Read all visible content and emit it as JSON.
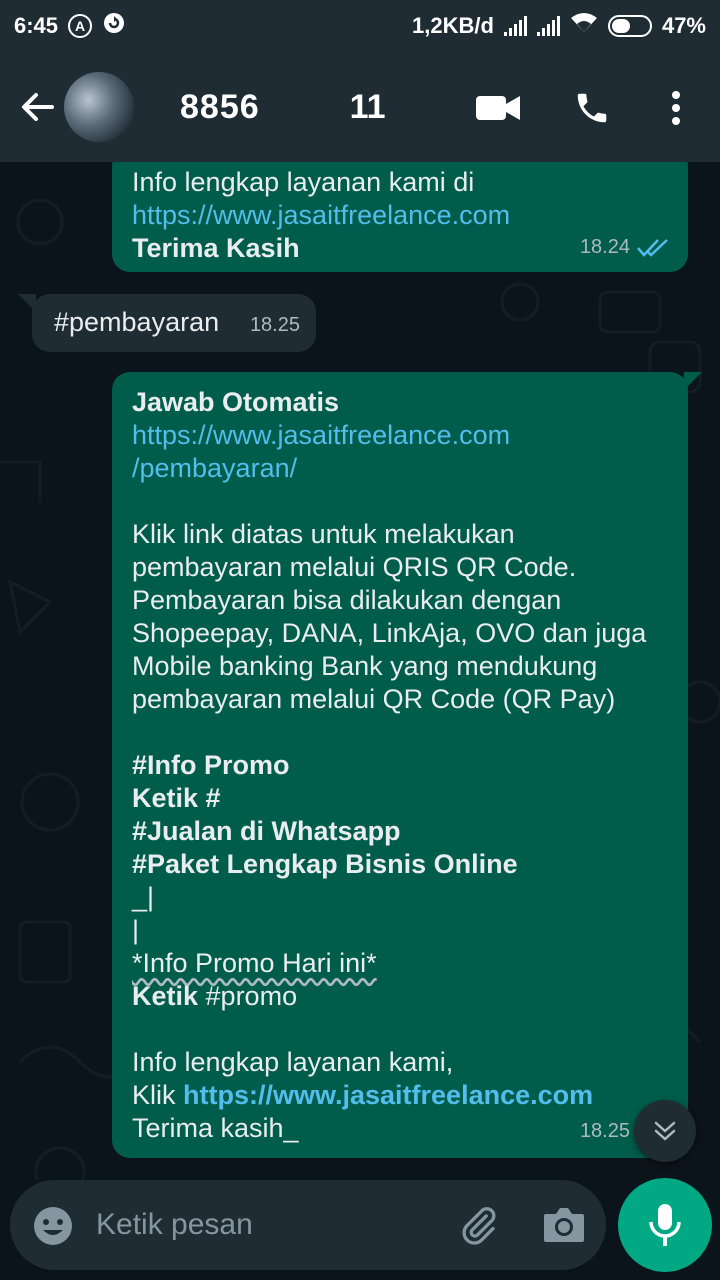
{
  "status_bar": {
    "time": "6:45",
    "network_speed": "1,2KB/d",
    "battery": "47%",
    "battery_level": 0.47
  },
  "header": {
    "contact_name": "8856",
    "contact_extra": "11",
    "icons": [
      "back-arrow-icon",
      "video-call-icon",
      "voice-call-icon",
      "more-options-icon"
    ]
  },
  "messages": {
    "m1": {
      "line1": "Info lengkap layanan kami  di",
      "link": "https://www.jasaitfreelance.com",
      "line3": "Terima Kasih",
      "time": "18.24"
    },
    "m2": {
      "text": "#pembayaran",
      "time": "18.25"
    },
    "m3": {
      "title": "Jawab Otomatis",
      "link1": "https://www.jasaitfreelance.com",
      "link2": "/pembayaran/",
      "p1": "Klik link diatas untuk melakukan",
      "p2": "pembayaran melalui QRIS QR Code.",
      "p3": "Pembayaran bisa dilakukan dengan",
      "p4": "Shopeepay, DANA, LinkAja, OVO dan juga",
      "p5": "Mobile banking Bank yang mendukung",
      "p6": "pembayaran melalui QR Code (QR Pay)",
      "h1": "#Info Promo",
      "h2": "Ketik #",
      "h3": "#Jualan di Whatsapp",
      "h4": "#Paket Lengkap Bisnis Online",
      "h5": "_|",
      "h6": "|",
      "promo": "*Info Promo Hari ini*",
      "ketik_prefix": "Ketik",
      "ketik_value": " #promo",
      "info": "Info lengkap layanan kami,",
      "klik_prefix": "Klik ",
      "klik_link": "https://www.jasaitfreelance.com",
      "closing": "Terima kasih_",
      "time": "18.25"
    }
  },
  "composer": {
    "placeholder": "Ketik pesan"
  },
  "colors": {
    "outgoing_bubble": "#005c4b",
    "incoming_bubble": "#202c33",
    "link": "#53bdeb",
    "accent": "#00a884",
    "read_ticks": "#53bdeb"
  }
}
